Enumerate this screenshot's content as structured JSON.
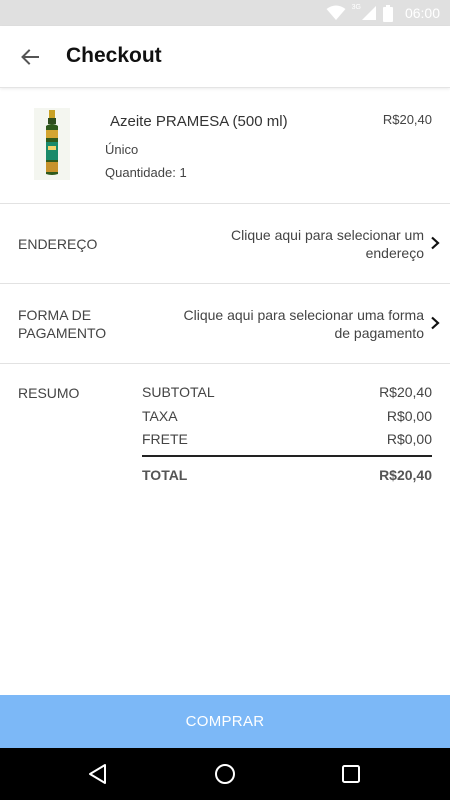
{
  "status_bar": {
    "time": "06:00",
    "network": "3G"
  },
  "app_bar": {
    "title": "Checkout"
  },
  "product": {
    "name": "Azeite PRAMESA (500 ml)",
    "price": "R$20,40",
    "variant": "Único",
    "quantity": "Quantidade: 1"
  },
  "address": {
    "label": "ENDEREÇO",
    "value_line1": "Clique aqui para selecionar um",
    "value_line2": "endereço"
  },
  "payment": {
    "label_line1": "FORMA DE",
    "label_line2": "PAGAMENTO",
    "value_line1": "Clique aqui para selecionar uma forma",
    "value_line2": "de pagamento"
  },
  "summary": {
    "label": "RESUMO",
    "subtotal_label": "SUBTOTAL",
    "subtotal_value": "R$20,40",
    "tax_label": "TAXA",
    "tax_value": "R$0,00",
    "shipping_label": "FRETE",
    "shipping_value": "R$0,00",
    "total_label": "TOTAL",
    "total_value": "R$20,40"
  },
  "buy_button": {
    "label": "COMPRAR",
    "color": "#7cb8f7"
  },
  "icons": {
    "back": "arrow-back-icon",
    "chevron": "chevron-right-icon",
    "nav_back": "triangle-back-icon",
    "nav_home": "circle-home-icon",
    "nav_recents": "square-recents-icon"
  }
}
